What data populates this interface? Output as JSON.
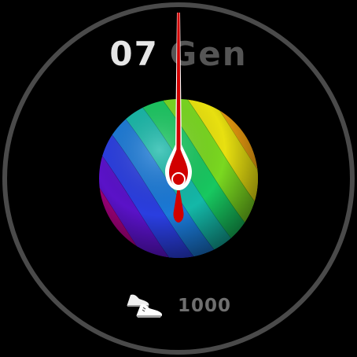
{
  "watch_face": {
    "date": {
      "day": "07",
      "month": "Gen"
    },
    "steps": {
      "value": "1000",
      "icon": "sneakers-icon"
    },
    "colors": {
      "background": "#000000",
      "ring": "#4a4a4a",
      "day_text": "#e6e6e6",
      "month_text": "#555555",
      "steps_text": "#6f6f6f",
      "hand": "#d10000",
      "hand_outline": "#ffffff"
    },
    "sphere": {
      "stripe_colors": [
        "#e8001c",
        "#a0007a",
        "#5a12c8",
        "#2a3ee0",
        "#1a7ad8",
        "#14b8a8",
        "#18c860",
        "#7ad820",
        "#e8e010",
        "#f0a010",
        "#f06010",
        "#e82810"
      ]
    }
  }
}
